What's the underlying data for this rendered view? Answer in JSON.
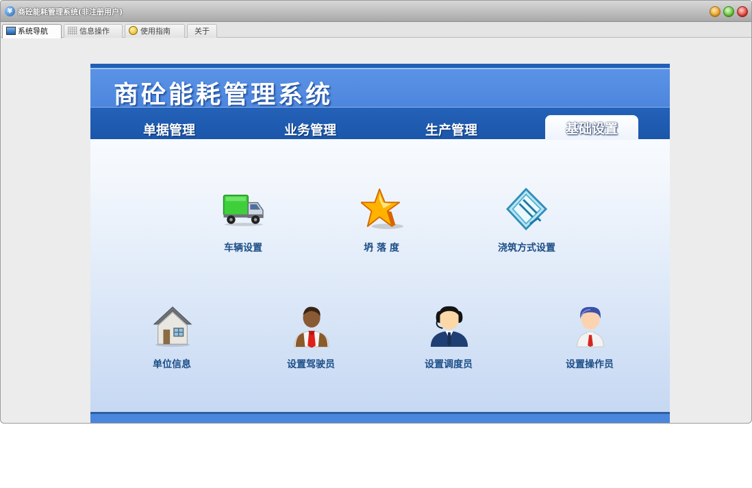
{
  "window": {
    "title": "商砼能耗管理系统(非注册用户)"
  },
  "tabs": [
    {
      "label": "系统导航",
      "icon": "monitor-icon",
      "active": true
    },
    {
      "label": "信息操作",
      "icon": "grid-icon",
      "active": false
    },
    {
      "label": "使用指南",
      "icon": "guide-icon",
      "active": false
    },
    {
      "label": "关于",
      "icon": "",
      "active": false
    }
  ],
  "header": {
    "title": "商砼能耗管理系统"
  },
  "nav": [
    {
      "label": "单据管理",
      "active": false
    },
    {
      "label": "业务管理",
      "active": false
    },
    {
      "label": "生产管理",
      "active": false
    },
    {
      "label": "基础设置",
      "active": true
    }
  ],
  "tiles": [
    {
      "label": "车辆设置",
      "icon": "truck-icon"
    },
    {
      "label": "坍 落 度",
      "icon": "star-icon"
    },
    {
      "label": "浇筑方式设置",
      "icon": "diamond-icon"
    },
    {
      "label": "单位信息",
      "icon": "house-icon"
    },
    {
      "label": "设置驾驶员",
      "icon": "driver-icon"
    },
    {
      "label": "设置调度员",
      "icon": "dispatcher-icon"
    },
    {
      "label": "设置操作员",
      "icon": "operator-icon"
    }
  ],
  "colors": {
    "header_blue": "#5a93e6",
    "nav_blue": "#1b56aa",
    "label_blue": "#1c4e86"
  }
}
